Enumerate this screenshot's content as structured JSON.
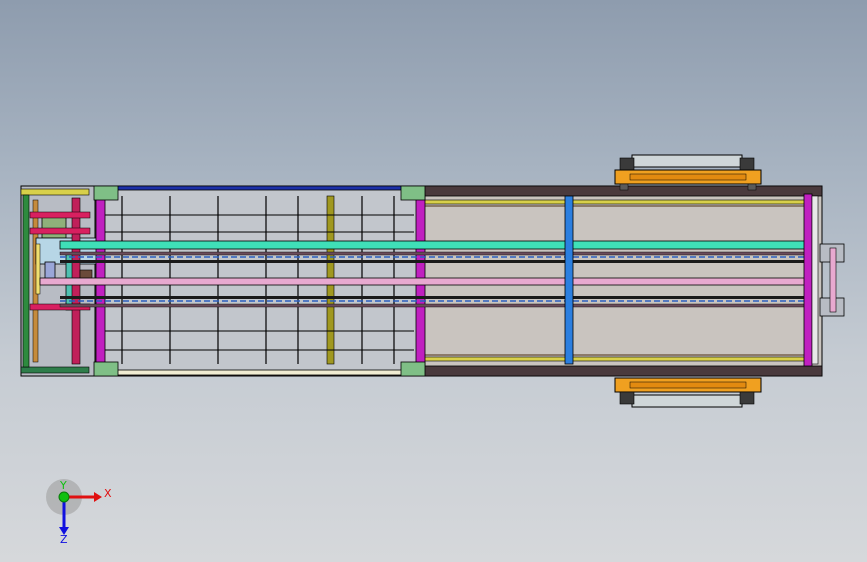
{
  "viewport": {
    "background_top": "#8e9cae",
    "background_bottom": "#d6d8db"
  },
  "model": {
    "view": "top",
    "outline_color": "#000000",
    "colors": {
      "outer_frame": "#4a3a3d",
      "top_beam": "#1a2fa8",
      "magenta_post": "#c020c0",
      "green_plate": "#7fbf86",
      "cyan_rail": "#3fe0b8",
      "pink_rail": "#e8a9d0",
      "blue_post": "#2b7fe0",
      "orange_carriage": "#f0a020",
      "olive_bar": "#a09820",
      "yellow_rail": "#d8d04a"
    }
  },
  "triad": {
    "x_label": "X",
    "y_label": "Y",
    "z_label": "Z",
    "x_color": "#e01010",
    "y_color": "#10c010",
    "z_color": "#1010e0"
  }
}
